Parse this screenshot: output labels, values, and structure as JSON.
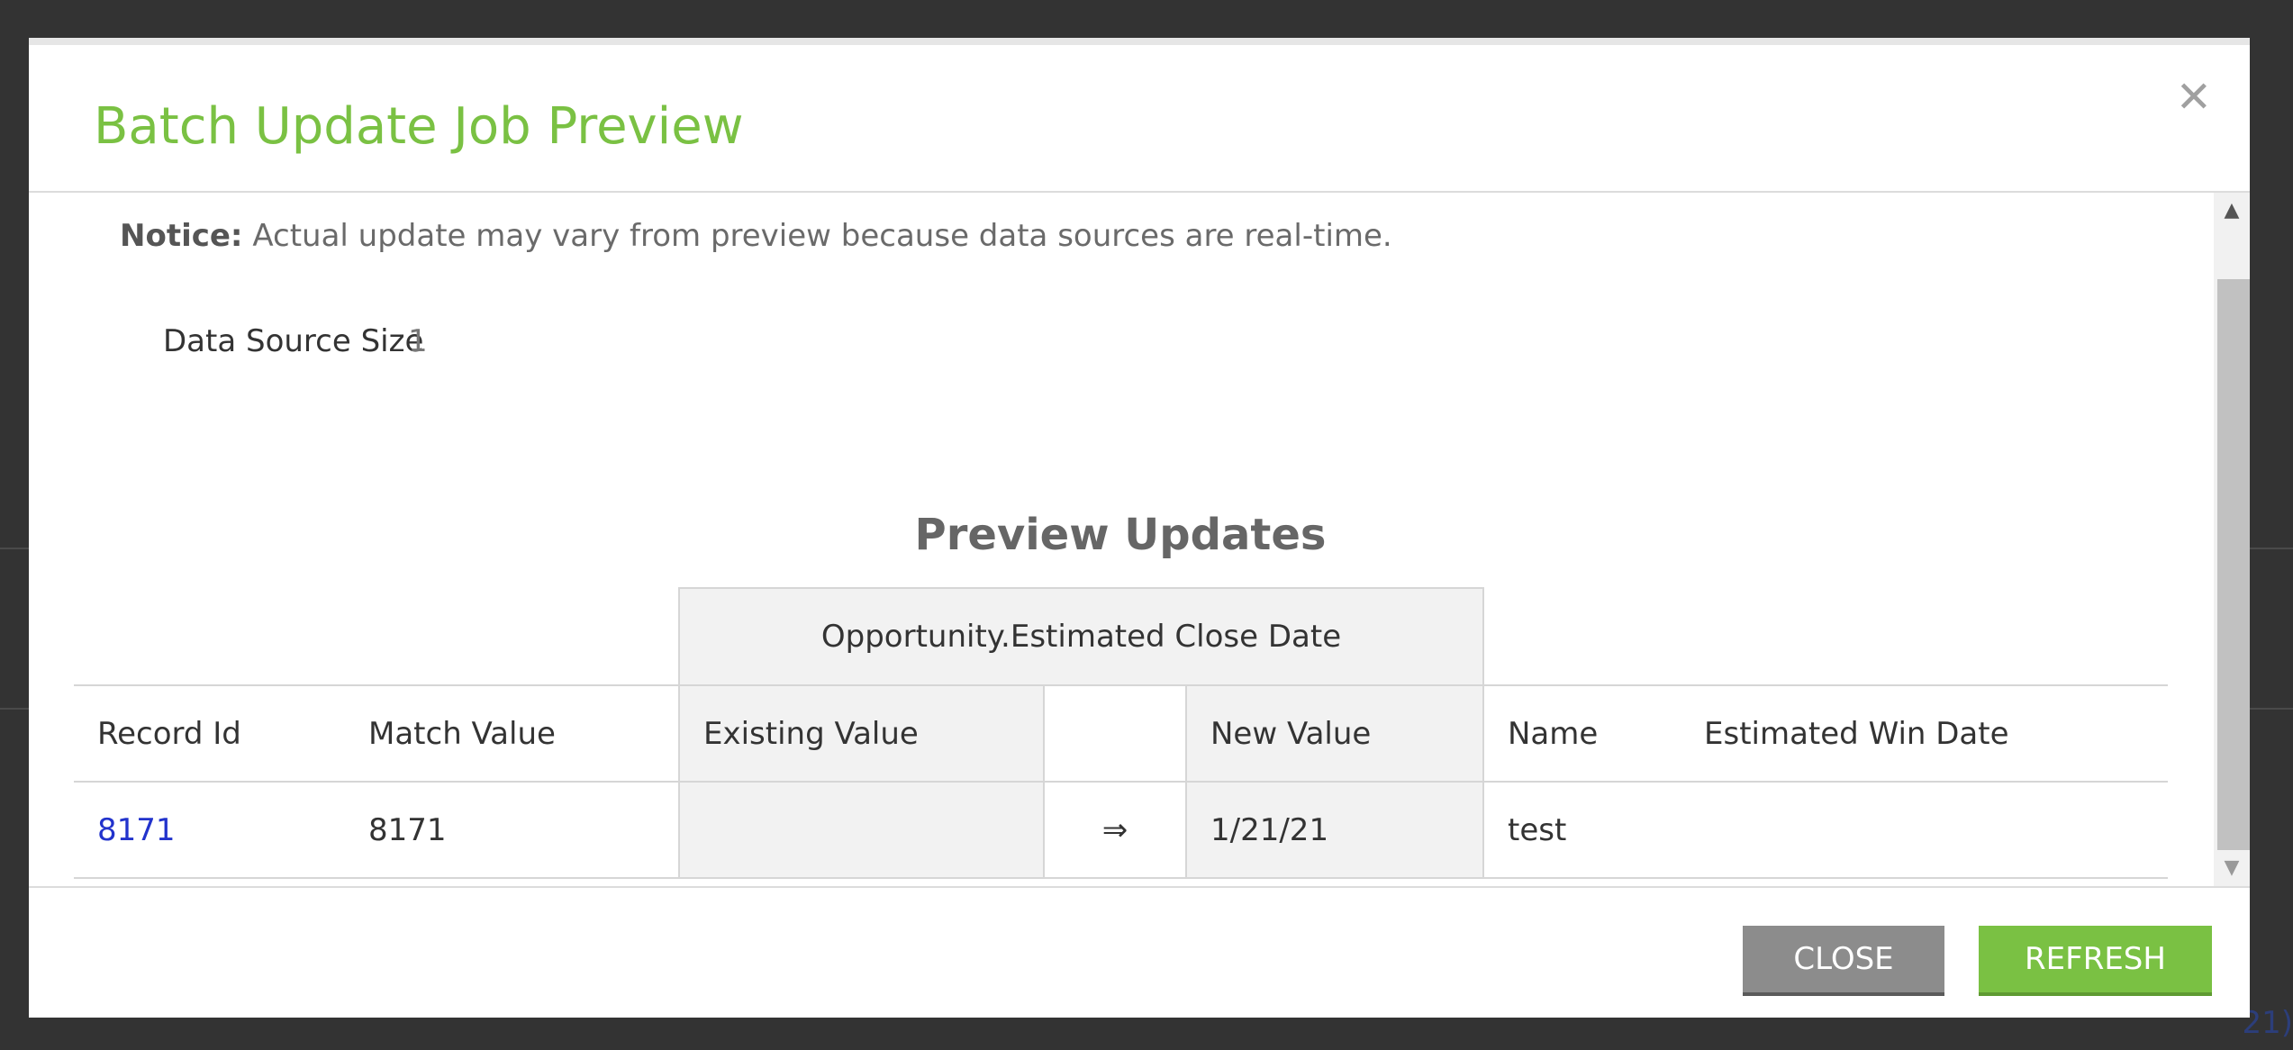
{
  "modal": {
    "title": "Batch Update Job Preview",
    "close_icon": "close-icon"
  },
  "notice": {
    "label": "Notice:",
    "text": "Actual update may vary from preview because data sources are real-time."
  },
  "data_source": {
    "label": "Data Source Size",
    "value": "1"
  },
  "preview": {
    "title": "Preview Updates",
    "group_header": "Opportunity.Estimated Close Date",
    "columns": {
      "record_id": "Record Id",
      "match_value": "Match Value",
      "existing_value": "Existing Value",
      "new_value": "New Value",
      "name": "Name",
      "estimated_win_date": "Estimated Win Date"
    },
    "rows": [
      {
        "record_id": "8171",
        "match_value": "8171",
        "existing_value": "",
        "arrow": "⇒",
        "new_value": "1/21/21",
        "name": "test",
        "estimated_win_date": ""
      }
    ]
  },
  "footer": {
    "close_label": "CLOSE",
    "refresh_label": "REFRESH"
  },
  "background": {
    "fragment_text": "21)"
  },
  "colors": {
    "accent": "#7ac143",
    "close_button": "#8c8c8c",
    "link": "#2233cc",
    "overlay": "#333333"
  }
}
